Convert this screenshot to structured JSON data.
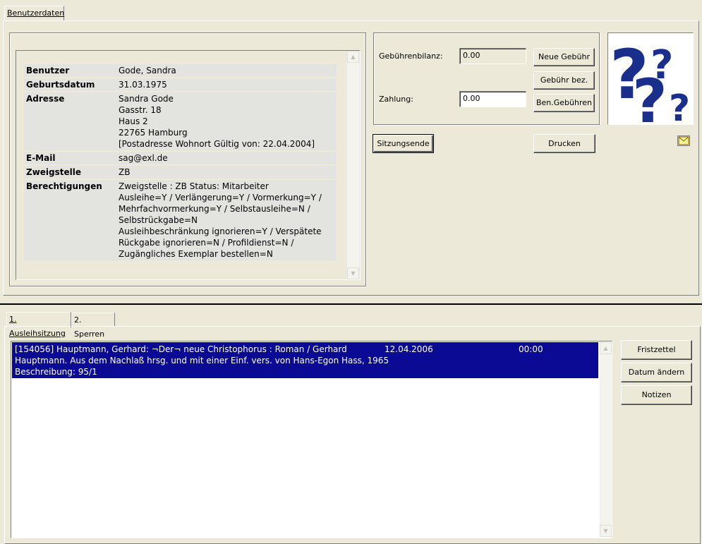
{
  "top_tabs": [
    {
      "label": "Benutzerdaten"
    }
  ],
  "user": {
    "rows": [
      {
        "key": "Benutzer",
        "value": "Gode, Sandra"
      },
      {
        "key": "Geburtsdatum",
        "value": "31.03.1975"
      },
      {
        "key": "Adresse",
        "value": "Sandra Gode\nGasstr. 18\nHaus 2\n22765 Hamburg\n[Postadresse Wohnort Gültig von: 22.04.2004]"
      },
      {
        "key": "E-Mail",
        "value": "sag@exl.de"
      },
      {
        "key": "Zweigstelle",
        "value": "ZB"
      },
      {
        "key": "Berechtigungen",
        "value": "Zweigstelle : ZB Status: Mitarbeiter\nAusleihe=Y / Verlängerung=Y / Vormerkung=Y /\nMehrfachvormerkung=Y / Selbstausleihe=N /\nSelbstrückgabe=N\nAusleihbeschränkung ignorieren=Y / Verspätete\nRückgabe ignorieren=N / Profildienst=N /\nZugängliches Exemplar bestellen=N"
      }
    ]
  },
  "fees": {
    "balance_label": "Gebührenbilanz:",
    "balance_value": "0.00",
    "payment_label": "Zahlung:",
    "payment_value": "0.00",
    "btn_new_fee": "Neue Gebühr",
    "btn_pay_fee": "Gebühr bez.",
    "btn_user_fees": "Ben.Gebühren"
  },
  "actions": {
    "session_end": "Sitzungsende",
    "print": "Drucken"
  },
  "bottom_tabs": [
    {
      "label": "1. Ausleihsitzung"
    },
    {
      "label": "2. Sperren"
    }
  ],
  "loans": {
    "rows": [
      {
        "title_line1": "[154056] Hauptmann, Gerhard: ¬Der¬ neue Christophorus : Roman / Gerhard",
        "title_line2": "Hauptmann. Aus dem Nachlaß hrsg. und mit einer Einf. vers. von Hans-Egon Hass, 1965",
        "title_line3": "Beschreibung: 95/1",
        "date": "12.04.2006",
        "time": "00:00"
      }
    ]
  },
  "loan_buttons": {
    "slip": "Fristzettel",
    "change_date": "Datum ändern",
    "notes": "Notizen"
  },
  "colors": {
    "window_bg": "#ece9d8",
    "selection": "#0a0a94",
    "help_icon_blue": "#1a2f8c"
  },
  "icons": {
    "help": "question-marks-icon",
    "mail": "envelope-icon"
  }
}
